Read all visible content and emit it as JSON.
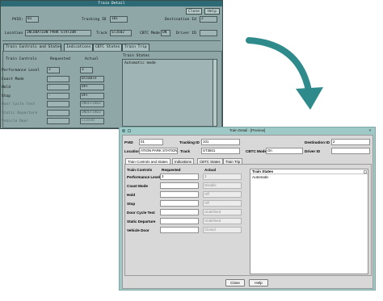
{
  "old": {
    "title": "Train Detail",
    "close": "Close",
    "help": "Help",
    "pvid_label": "PVID:",
    "pvid": "01",
    "tracking_label": "Tracking ID",
    "tracking": "101",
    "destination_label": "Destination Id",
    "destination": "2",
    "location_label": "Location",
    "location": "INCUBATION PARK STATION",
    "track_label": "Track",
    "track": "ST3502",
    "cbtc_label": "CBTC Mode",
    "cbtc": "ON",
    "driver_label": "Driver ID",
    "driver": "",
    "tabs": [
      "Train Controls and States",
      "Indications",
      "CBTC States",
      "Train Trip"
    ],
    "col_controls": "Train Controls",
    "col_requested": "Requested",
    "col_actual": "Actual",
    "rows": [
      {
        "label": "Performance Level",
        "req": "3",
        "act": "3"
      },
      {
        "label": "Coast Mode",
        "req": "-",
        "act": "Disable"
      },
      {
        "label": "Hold",
        "req": "-",
        "act": "OFF"
      },
      {
        "label": "Stop",
        "req": "-",
        "act": "OFF"
      },
      {
        "label": "Door Cycle Test",
        "req": "",
        "act": "UNDEFINED"
      },
      {
        "label": "Static Departure",
        "req": "",
        "act": "UNDEFINED"
      },
      {
        "label": "Vehicle Door",
        "req": "",
        "act": "Closed"
      }
    ],
    "states_label": "Train States",
    "states_text": "Automatic mode"
  },
  "new": {
    "title": "Train Detail - [Preview]",
    "pvid_label": "PVID",
    "pvid": "01",
    "tracking_label": "Tracking ID",
    "tracking": "101",
    "destination_label": "Destination ID",
    "destination": "2",
    "location_label": "Location",
    "location": "ATION PARK STATION",
    "track_label": "Track",
    "track": "ST3501",
    "cbtc_label": "CBTC Mode",
    "cbtc": "On",
    "driver_label": "Driver ID",
    "driver": "",
    "tabs": [
      "Train Controls and States",
      "Indications",
      "CBTC States",
      "Train Trip"
    ],
    "col_controls": "Train Controls",
    "col_requested": "Requested",
    "col_actual": "Actual",
    "rows": [
      {
        "label": "Performance Level",
        "req": "3",
        "act": "3"
      },
      {
        "label": "Coast Mode",
        "req": "",
        "act": "Disable"
      },
      {
        "label": "Hold",
        "req": "",
        "act": "Off"
      },
      {
        "label": "Stop",
        "req": "",
        "act": "Off"
      },
      {
        "label": "Door Cycle Test",
        "req": "",
        "act": "Undefined"
      },
      {
        "label": "Static Departure",
        "req": "",
        "act": "Undefined"
      },
      {
        "label": "Vehicle Door",
        "req": "",
        "act": "Closed"
      }
    ],
    "states_label": "Train States",
    "states_text": "Automatic",
    "close": "Close",
    "help": "Help"
  },
  "colors": {
    "old_bg": "#8fa7a7",
    "old_title": "#2c6b75",
    "new_frame": "#9ec9c7",
    "new_bg": "#d8d8d8",
    "arrow": "#2f8a8c"
  }
}
